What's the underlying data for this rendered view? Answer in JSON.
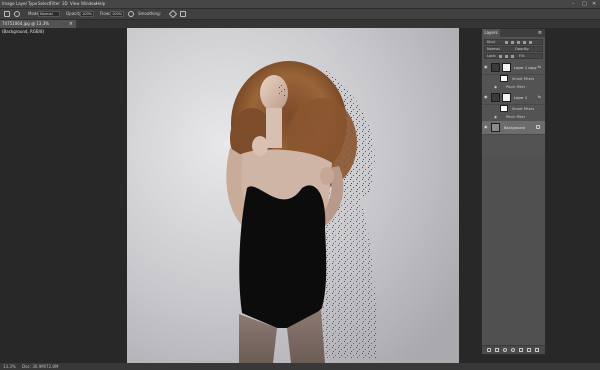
{
  "menubar": {
    "items": [
      "Image",
      "Layer",
      "Type",
      "Select",
      "Filter",
      "3D",
      "View",
      "Window",
      "Help"
    ],
    "controls": [
      "–",
      "□",
      "✕"
    ]
  },
  "options": {
    "mode_label": "Mode:",
    "mode_value": "Normal",
    "opacity_label": "Opacity:",
    "opacity_value": "100%",
    "flow_label": "Flow:",
    "flow_value": "100%",
    "smoothing_label": "Smoothing:"
  },
  "document_tab": {
    "title": "74751064.jpg @ 13.3% (Background, RGB/8)",
    "close": "×"
  },
  "layers_panel": {
    "tab": "Layers",
    "menu": "≡",
    "kind_filter": "Kind",
    "blend_mode": "Normal",
    "opacity_label": "Opacity:",
    "lock_label": "Lock:",
    "fill_label": "Fill:",
    "layers": [
      {
        "name": "Layer 1 copy",
        "selected": false,
        "fx": "fx"
      },
      {
        "name": "Smart Filters",
        "sub": true
      },
      {
        "name": "Pinch Filter",
        "sub": true
      },
      {
        "name": "Layer 1",
        "selected": false,
        "fx": "fx"
      },
      {
        "name": "Smart Filters",
        "sub": true
      },
      {
        "name": "Pinch Filter",
        "sub": true
      },
      {
        "name": "Background",
        "selected": true
      }
    ]
  },
  "status": {
    "zoom": "13.3%",
    "doc": "Doc: 30.9M/72.8M"
  }
}
